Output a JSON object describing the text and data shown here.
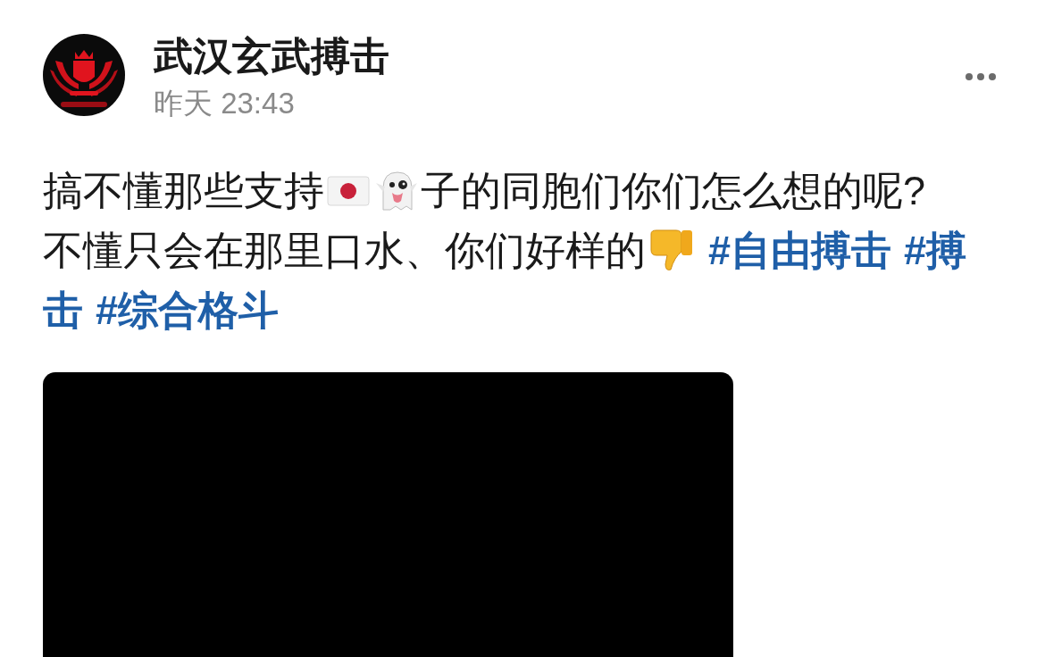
{
  "post": {
    "author": "武汉玄武搏击",
    "time": "昨天 23:43",
    "lines": [
      [
        {
          "kind": "text",
          "text": "搞不懂那些支持"
        },
        {
          "kind": "flag"
        },
        {
          "kind": "ghost"
        },
        {
          "kind": "text",
          "text": "子的同胞们你们怎么想的呢?"
        }
      ],
      [
        {
          "kind": "text",
          "text": "不懂只会在那里口水、你们好样的"
        },
        {
          "kind": "thumbs_down"
        },
        {
          "kind": "hashtag",
          "text": "#自由搏击"
        },
        {
          "kind": "hashtag",
          "text": "#搏"
        }
      ],
      [
        {
          "kind": "hashtag",
          "text": "击"
        },
        {
          "kind": "hashtag",
          "text": "#综合格斗"
        }
      ]
    ],
    "media": {
      "kind": "video"
    }
  }
}
